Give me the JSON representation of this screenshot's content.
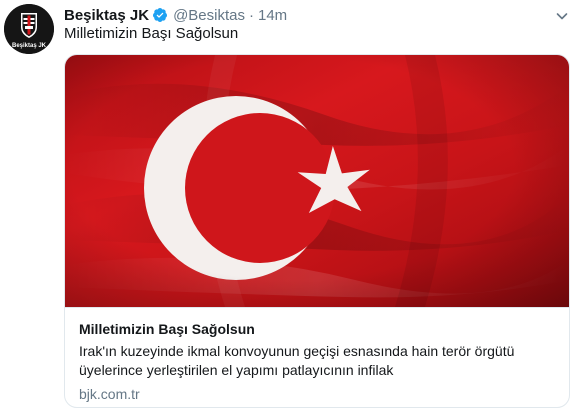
{
  "author": {
    "display_name": "Beşiktaş JK",
    "handle": "@Besiktas",
    "separator": "·",
    "time": "14m",
    "avatar_text": "Beşiktaş JK",
    "verified_icon": "verified-badge-icon"
  },
  "tweet": {
    "text": "Milletimizin Başı Sağolsun"
  },
  "card": {
    "image_icon": "turkish-flag-image",
    "title": "Milletimizin Başı Sağolsun",
    "description": "Irak'ın kuzeyinde ikmal konvoyunun geçişi esnasında hain terör örgütü üyelerince yerleştirilen el yapımı patlayıcının infilak",
    "domain": "bjk.com.tr"
  },
  "colors": {
    "text_primary": "#14171a",
    "text_secondary": "#657786",
    "verified_blue": "#1da1f2",
    "card_border": "#e1e8ed",
    "flag_red": "#d0161a"
  }
}
